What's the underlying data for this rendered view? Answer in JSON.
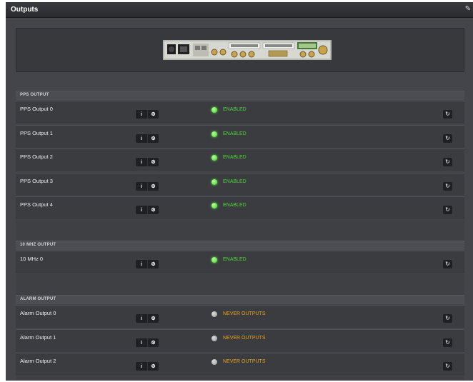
{
  "window": {
    "title": "Outputs",
    "corner_icon": "edit-icon"
  },
  "colors": {
    "enabled": "#4fd33a",
    "never": "#e6a317"
  },
  "buttons": {
    "info": "i",
    "settings": "⚙",
    "refresh": "↻"
  },
  "sections": [
    {
      "label": "PPS OUTPUT",
      "rows": [
        {
          "name": "PPS Output 0",
          "status": "ENABLED",
          "state": "on"
        },
        {
          "name": "PPS Output 1",
          "status": "ENABLED",
          "state": "on"
        },
        {
          "name": "PPS Output 2",
          "status": "ENABLED",
          "state": "on"
        },
        {
          "name": "PPS Output 3",
          "status": "ENABLED",
          "state": "on"
        },
        {
          "name": "PPS Output 4",
          "status": "ENABLED",
          "state": "on"
        }
      ]
    },
    {
      "label": "10 MHZ OUTPUT",
      "rows": [
        {
          "name": "10 MHz 0",
          "status": "ENABLED",
          "state": "on"
        }
      ]
    },
    {
      "label": "ALARM OUTPUT",
      "rows": [
        {
          "name": "Alarm Output 0",
          "status": "NEVER OUTPUTS",
          "state": "off"
        },
        {
          "name": "Alarm Output 1",
          "status": "NEVER OUTPUTS",
          "state": "off"
        },
        {
          "name": "Alarm Output 2",
          "status": "NEVER OUTPUTS",
          "state": "off"
        }
      ]
    }
  ]
}
